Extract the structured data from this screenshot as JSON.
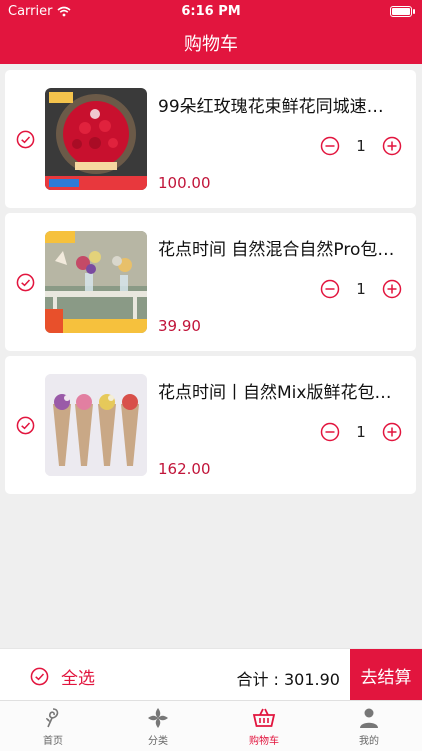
{
  "status_bar": {
    "carrier": "Carrier",
    "time": "6:16 PM"
  },
  "nav": {
    "title": "购物车"
  },
  "colors": {
    "accent": "#e2153e",
    "price": "#c1153a"
  },
  "cart": {
    "items": [
      {
        "title": "99朵红玫瑰花束鲜花同城速…",
        "price": "100.00",
        "quantity": "1",
        "checked": true
      },
      {
        "title": "花点时间 自然混合自然Pro包…",
        "price": "39.90",
        "quantity": "1",
        "checked": true
      },
      {
        "title": "花点时间丨自然Mix版鲜花包…",
        "price": "162.00",
        "quantity": "1",
        "checked": true
      }
    ]
  },
  "checkout": {
    "select_all": "全选",
    "total": "合计 : 301.90",
    "pay": "去结算"
  },
  "tabs": [
    {
      "label": "首页",
      "icon": "rose-icon"
    },
    {
      "label": "分类",
      "icon": "petals-icon"
    },
    {
      "label": "购物车",
      "icon": "basket-icon",
      "active": true
    },
    {
      "label": "我的",
      "icon": "person-icon"
    }
  ]
}
